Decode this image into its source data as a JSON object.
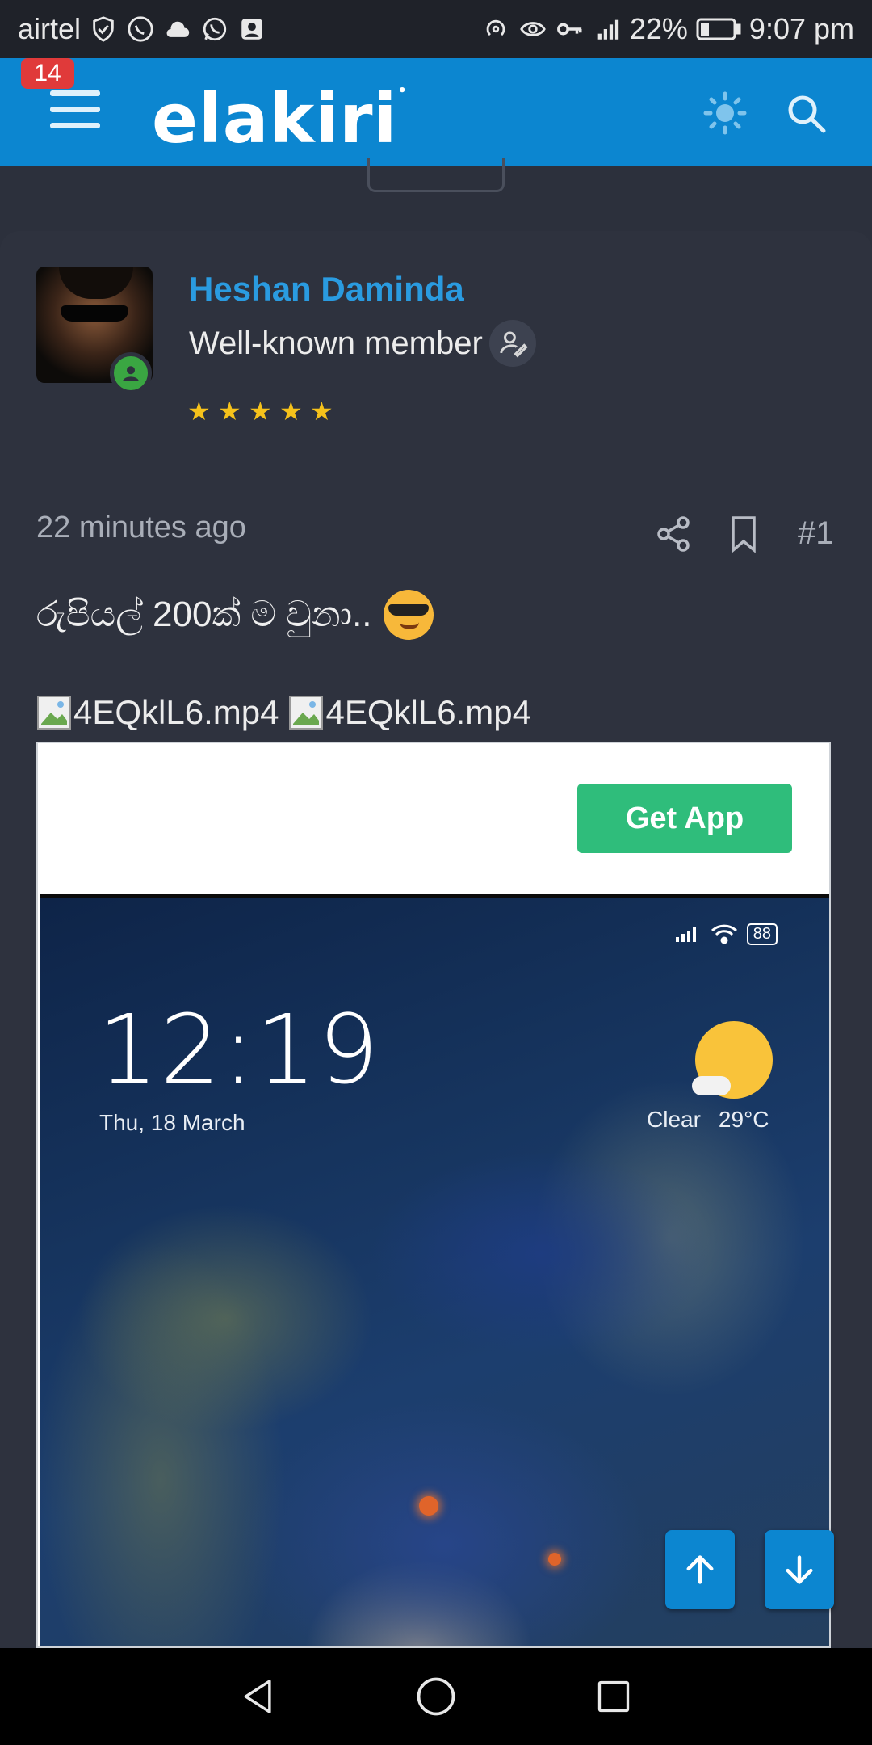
{
  "status_bar": {
    "carrier": "airtel",
    "battery": "22%",
    "time": "9:07 pm",
    "icons_left": [
      "shield-check-icon",
      "phone-call-icon",
      "cloud-icon",
      "whatsapp-icon",
      "contact-icon"
    ],
    "icons_right": [
      "hotspot-icon",
      "eye-icon",
      "key-icon",
      "signal-icon",
      "battery-icon"
    ]
  },
  "header": {
    "notification_count": "14",
    "logo_text": "elakiri",
    "brand_color": "#0c86d0"
  },
  "post": {
    "author": "Heshan Daminda",
    "user_title": "Well-known member",
    "star_count": 5,
    "timestamp": "22 minutes ago",
    "post_number": "#1",
    "body_text": "රුපියල් 200ක් ම වුනා..",
    "attachments": [
      {
        "name": "4EQklL6.mp4"
      },
      {
        "name": "4EQklL6.mp4"
      }
    ]
  },
  "ad": {
    "cta_label": "Get App",
    "cta_color": "#2fbd7b",
    "preview": {
      "clock": "12:19",
      "date": "Thu, 18 March",
      "weather_condition": "Clear",
      "temperature": "29°C",
      "battery": "88"
    }
  },
  "nav": {
    "buttons": [
      "back-icon",
      "home-icon",
      "recents-icon"
    ]
  }
}
